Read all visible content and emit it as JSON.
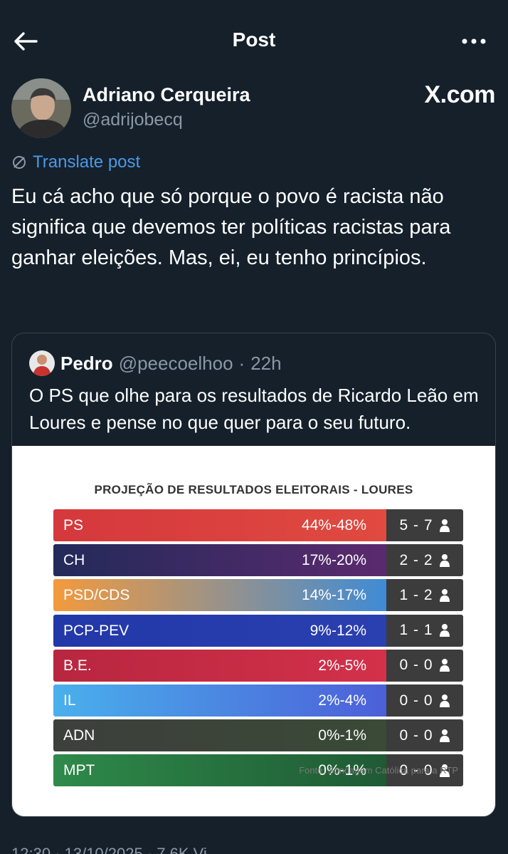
{
  "header": {
    "title": "Post"
  },
  "author": {
    "name": "Adriano Cerqueira",
    "handle": "@adrijobecq"
  },
  "watermark": "X.com",
  "translate_label": "Translate post",
  "post_text": "Eu cá acho que só porque o povo é racista não significa que devemos ter políticas racistas para ganhar eleições. Mas, ei, eu tenho princípios.",
  "quote": {
    "name": "Pedro",
    "handle": "@peecoelhoo",
    "separator": "·",
    "time": "22h",
    "text": "O PS que olhe para os resultados de Ricardo Leão em Loures e pense no que quer para o seu futuro."
  },
  "chart_data": {
    "type": "table",
    "title": "PROJEÇÃO DE RESULTADOS ELEITORAIS - LOURES",
    "source": "Fonte: Sondagem Católica para a RTP",
    "rows": [
      {
        "party": "PS",
        "range": "44%-48%",
        "seats": "5 - 7",
        "color_from": "#d5383d",
        "color_to": "#e04a40"
      },
      {
        "party": "CH",
        "range": "17%-20%",
        "seats": "2 - 2",
        "color_from": "#232a5a",
        "color_to": "#5b2a6e"
      },
      {
        "party": "PSD/CDS",
        "range": "14%-17%",
        "seats": "1 - 2",
        "color_from": "#f39a3d",
        "color_to": "#3f8bd6"
      },
      {
        "party": "PCP-PEV",
        "range": "9%-12%",
        "seats": "1 - 1",
        "color_from": "#2238a8",
        "color_to": "#2a3fb0"
      },
      {
        "party": "B.E.",
        "range": "2%-5%",
        "seats": "0 - 0",
        "color_from": "#b8263f",
        "color_to": "#d3314a"
      },
      {
        "party": "IL",
        "range": "2%-4%",
        "seats": "0 - 0",
        "color_from": "#4ab0ec",
        "color_to": "#4c5fd8"
      },
      {
        "party": "ADN",
        "range": "0%-1%",
        "seats": "0 - 0",
        "color_from": "#3d3f3c",
        "color_to": "#3a4a36"
      },
      {
        "party": "MPT",
        "range": "0%-1%",
        "seats": "0 - 0",
        "color_from": "#2e8a4a",
        "color_to": "#1f5a34"
      }
    ]
  },
  "footer": {
    "partial_text": "12:30 · 13/10/2025 · 7,6K Vi"
  }
}
